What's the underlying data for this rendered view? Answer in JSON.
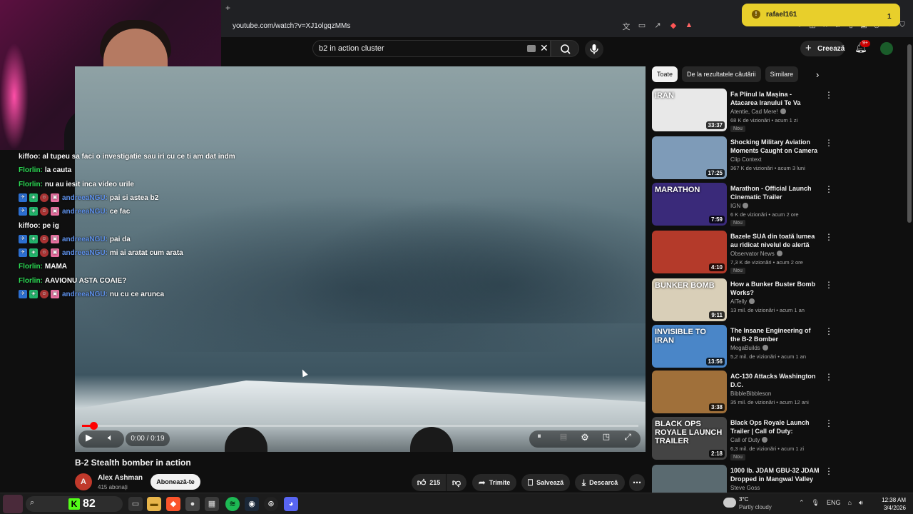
{
  "browser": {
    "new_tab": "+",
    "url": "youtube.com/watch?v=XJ1olgqzMMs",
    "window_controls": [
      "–",
      "❐",
      "✕"
    ]
  },
  "notification": {
    "user": "rafael161",
    "count": "1"
  },
  "youtube_header": {
    "search_query": "b2 in action cluster",
    "create_label": "Creează",
    "notifications_badge": "9+"
  },
  "chat": [
    {
      "user": "kiffoo:",
      "user_color": "white",
      "badges": [],
      "message": "al tupeu sa faci o investigatie sau iri cu ce ti am dat indm"
    },
    {
      "user": "Florlin:",
      "user_color": "green",
      "badges": [],
      "message": "la cauta"
    },
    {
      "user": "Florlin:",
      "user_color": "green",
      "badges": [],
      "message": "nu au iesit inca video urile"
    },
    {
      "user": "andreeaNGU:",
      "user_color": "blue",
      "badges": [
        "a",
        "g",
        "r",
        "p"
      ],
      "message": "pai si astea b2"
    },
    {
      "user": "andreeaNGU:",
      "user_color": "blue",
      "badges": [
        "a",
        "g",
        "r",
        "p"
      ],
      "message": "ce fac"
    },
    {
      "user": "kiffoo:",
      "user_color": "white",
      "badges": [],
      "message": "pe ig"
    },
    {
      "user": "andreeaNGU:",
      "user_color": "blue",
      "badges": [
        "a",
        "g",
        "r",
        "p"
      ],
      "message": "pai da"
    },
    {
      "user": "andreeaNGU:",
      "user_color": "blue",
      "badges": [
        "a",
        "g",
        "r",
        "p"
      ],
      "message": "mi ai aratat cum arata"
    },
    {
      "user": "Florlin:",
      "user_color": "green",
      "badges": [],
      "message": "MAMA"
    },
    {
      "user": "Florlin:",
      "user_color": "green",
      "badges": [],
      "message": "AAVIONU ASTA COAIE?"
    },
    {
      "user": "andreeaNGU:",
      "user_color": "blue",
      "badges": [
        "a",
        "g",
        "r",
        "p"
      ],
      "message": "nu cu ce arunca"
    }
  ],
  "player": {
    "time": "0:00 / 0:19",
    "progress_fraction": 0.02
  },
  "video": {
    "title": "B-2 Stealth bomber in action",
    "channel": "Alex Ashman",
    "channel_initial": "A",
    "subscribers": "415 abonați",
    "subscribe_label": "Abonează-te",
    "likes": "215",
    "share_label": "Trimite",
    "save_label": "Salvează",
    "download_label": "Descarcă"
  },
  "sidebar": {
    "chips": [
      "Toate",
      "De la rezultatele căutării",
      "Similare"
    ],
    "recommendations": [
      {
        "title": "Fa Plinul la Mașina - Atacarea Iranului Te Va Afecta, Ca Vrei, ...",
        "channel": "Atentie, Cad Mere!",
        "verified": true,
        "meta": "68 K de vizionări • acum 1 zi",
        "duration": "33:37",
        "badge_new": "Nou",
        "thumb_text": "IRAN",
        "thumb_color": "#e8e8e8"
      },
      {
        "title": "Shocking Military Aviation Moments Caught on Camera",
        "channel": "Clip Context",
        "verified": false,
        "meta": "367 K de vizionări • acum 3 luni",
        "duration": "17:25",
        "badge_new": "",
        "thumb_text": "",
        "thumb_color": "#7e9bb8"
      },
      {
        "title": "Marathon - Official Launch Cinematic Trailer",
        "channel": "IGN",
        "verified": true,
        "meta": "6 K de vizionări • acum 2 ore",
        "duration": "7:59",
        "badge_new": "Nou",
        "thumb_text": "MARATHON",
        "thumb_color": "#3a2a7a"
      },
      {
        "title": "Bazele SUA din toată lumea au ridicat nivelul de alertă după ...",
        "channel": "Observator News",
        "verified": true,
        "meta": "7,3 K de vizionări • acum 2 ore",
        "duration": "4:10",
        "badge_new": "Nou",
        "thumb_text": "",
        "thumb_color": "#b43a2a"
      },
      {
        "title": "How a Bunker Buster Bomb Works?",
        "channel": "AiTelly",
        "verified": true,
        "meta": "13 mil. de vizionări • acum 1 an",
        "duration": "9:11",
        "badge_new": "",
        "thumb_text": "BUNKER BOMB",
        "thumb_color": "#d9cfb8"
      },
      {
        "title": "The Insane Engineering of the B-2 Bomber",
        "channel": "MegaBuilds",
        "verified": true,
        "meta": "5,2 mil. de vizionări • acum 1 an",
        "duration": "13:56",
        "badge_new": "",
        "thumb_text": "INVISIBLE TO IRAN",
        "thumb_color": "#4a86c8"
      },
      {
        "title": "AC-130 Attacks Washington D.C.",
        "channel": "BibbleBibbleson",
        "verified": false,
        "meta": "35 mil. de vizionări • acum 12 ani",
        "duration": "3:38",
        "badge_new": "",
        "thumb_text": "",
        "thumb_color": "#a0703a"
      },
      {
        "title": "Black Ops Royale Launch Trailer | Call of Duty: Warzone",
        "channel": "Call of Duty",
        "verified": true,
        "meta": "6,3 mil. de vizionări • acum 1 zi",
        "duration": "2:18",
        "badge_new": "Nou",
        "thumb_text": "BLACK OPS ROYALE LAUNCH TRAILER",
        "thumb_color": "#444"
      },
      {
        "title": "1000 lb. JDAM GBU-32 JDAM Dropped in Mangwal Valley ...",
        "channel": "Steve Goss",
        "verified": false,
        "meta": "",
        "duration": "",
        "badge_new": "",
        "thumb_text": "",
        "thumb_color": "#5a6a70"
      }
    ]
  },
  "taskbar": {
    "count": "82",
    "weather_temp": "3°C",
    "weather_desc": "Partly cloudy",
    "lang": "ENG",
    "time": "12:38 AM",
    "date": "3/4/2026"
  }
}
